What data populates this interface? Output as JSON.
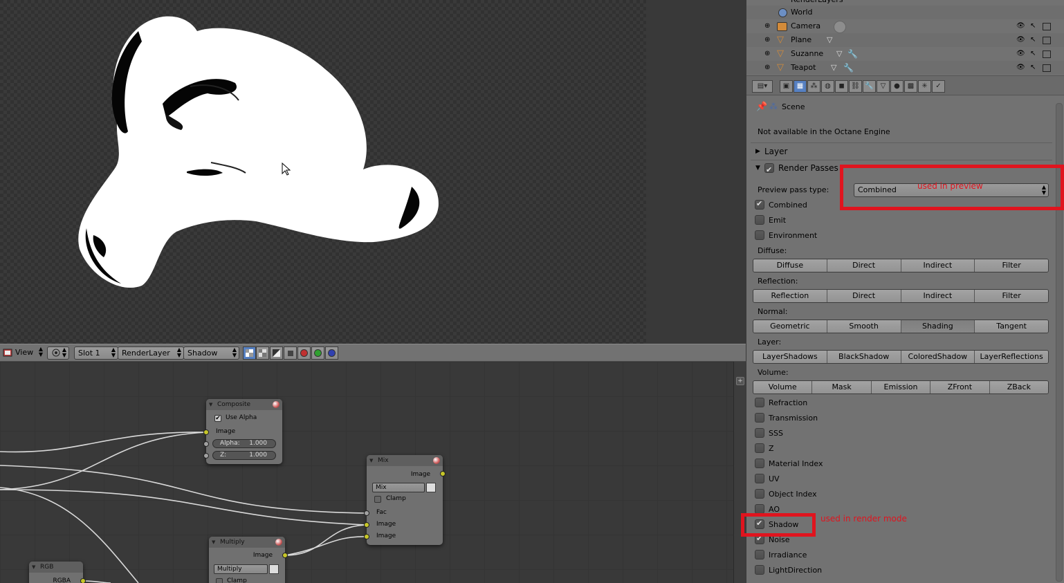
{
  "outliner": {
    "items": [
      {
        "label": "RenderLayers"
      },
      {
        "label": "World"
      },
      {
        "label": "Camera"
      },
      {
        "label": "Plane"
      },
      {
        "label": "Suzanne"
      },
      {
        "label": "Teapot"
      }
    ]
  },
  "image_header": {
    "view_label": "View",
    "slot_label": "Slot 1",
    "layer_label": "RenderLayer",
    "pass_label": "Shadow"
  },
  "properties": {
    "context_label": "Scene",
    "note": "Not available in the Octane Engine",
    "layer_panel_label": "Layer",
    "render_passes_label": "Render Passes",
    "preview_pass_label": "Preview pass type:",
    "preview_pass_value": "Combined",
    "checks_top": [
      {
        "label": "Combined",
        "checked": true
      },
      {
        "label": "Emit",
        "checked": false
      },
      {
        "label": "Environment",
        "checked": false
      }
    ],
    "diffuse_label": "Diffuse:",
    "diffuse_buttons": [
      "Diffuse",
      "Direct",
      "Indirect",
      "Filter"
    ],
    "reflection_label": "Reflection:",
    "reflection_buttons": [
      "Reflection",
      "Direct",
      "Indirect",
      "Filter"
    ],
    "normal_label": "Normal:",
    "normal_buttons": [
      "Geometric",
      "Smooth",
      "Shading",
      "Tangent"
    ],
    "layer_label": "Layer:",
    "layer_buttons": [
      "LayerShadows",
      "BlackShadow",
      "ColoredShadow",
      "LayerReflections"
    ],
    "volume_label": "Volume:",
    "volume_buttons": [
      "Volume",
      "Mask",
      "Emission",
      "ZFront",
      "ZBack"
    ],
    "checks_bottom": [
      {
        "label": "Refraction",
        "checked": false
      },
      {
        "label": "Transmission",
        "checked": false
      },
      {
        "label": "SSS",
        "checked": false
      },
      {
        "label": "Z",
        "checked": false
      },
      {
        "label": "Material Index",
        "checked": false
      },
      {
        "label": "UV",
        "checked": false
      },
      {
        "label": "Object Index",
        "checked": false
      },
      {
        "label": "AO",
        "checked": false
      },
      {
        "label": "Shadow",
        "checked": true
      },
      {
        "label": "Noise",
        "checked": true
      },
      {
        "label": "Irradiance",
        "checked": false
      },
      {
        "label": "LightDirection",
        "checked": false
      }
    ]
  },
  "annotations": {
    "preview_note": "used in preview",
    "render_note": "used in render mode",
    "color": "#e0141e"
  },
  "nodes": {
    "composite": {
      "title": "Composite",
      "use_alpha": "Use Alpha",
      "image": "Image",
      "alpha_label": "Alpha:",
      "alpha_value": "1.000",
      "z_label": "Z:",
      "z_value": "1.000"
    },
    "mix": {
      "title": "Mix",
      "out_image": "Image",
      "mode": "Mix",
      "clamp": "Clamp",
      "fac": "Fac",
      "in1": "Image",
      "in2": "Image"
    },
    "multiply": {
      "title": "Multiply",
      "out_image": "Image",
      "mode": "Multiply",
      "clamp": "Clamp"
    },
    "rgb": {
      "title": "RGB",
      "out": "RGBA"
    }
  }
}
